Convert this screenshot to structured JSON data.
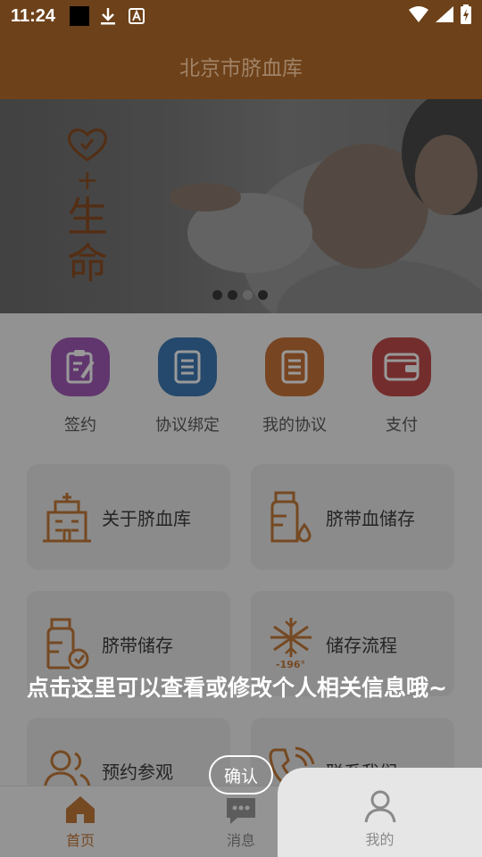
{
  "status_bar": {
    "time": "11:24"
  },
  "header": {
    "title": "北京市脐血库"
  },
  "banner": {
    "slogan_chars": [
      "生",
      "命"
    ],
    "slogan_plus": "+",
    "dot_count": 4,
    "active_dot_index": 2
  },
  "quick_actions": [
    {
      "label": "签约",
      "icon": "clipboard-sign-icon",
      "color": "#a25ab8"
    },
    {
      "label": "协议绑定",
      "icon": "document-icon",
      "color": "#3f7ab5"
    },
    {
      "label": "我的协议",
      "icon": "document-icon",
      "color": "#c8733a"
    },
    {
      "label": "支付",
      "icon": "wallet-icon",
      "color": "#c24c4c"
    }
  ],
  "cards": [
    {
      "label": "关于脐血库",
      "icon": "building-icon"
    },
    {
      "label": "脐带血储存",
      "icon": "blood-bottle-icon"
    },
    {
      "label": "脐带储存",
      "icon": "bottle-check-icon"
    },
    {
      "label": "储存流程",
      "icon": "snowflake-icon",
      "icon_text": "-196°"
    },
    {
      "label": "预约参观",
      "icon": "people-icon"
    },
    {
      "label": "联系我们",
      "icon": "phone-icon"
    }
  ],
  "guide": {
    "tip": "点击这里可以查看或修改个人相关信息哦~",
    "confirm_label": "确认"
  },
  "bottom_nav": [
    {
      "label": "首页",
      "icon": "home-icon",
      "active": true
    },
    {
      "label": "消息",
      "icon": "message-icon",
      "active": false
    },
    {
      "label": "我的",
      "icon": "user-icon",
      "active": false
    }
  ],
  "colors": {
    "brand": "#6d4119",
    "accent": "#c47a3a"
  }
}
